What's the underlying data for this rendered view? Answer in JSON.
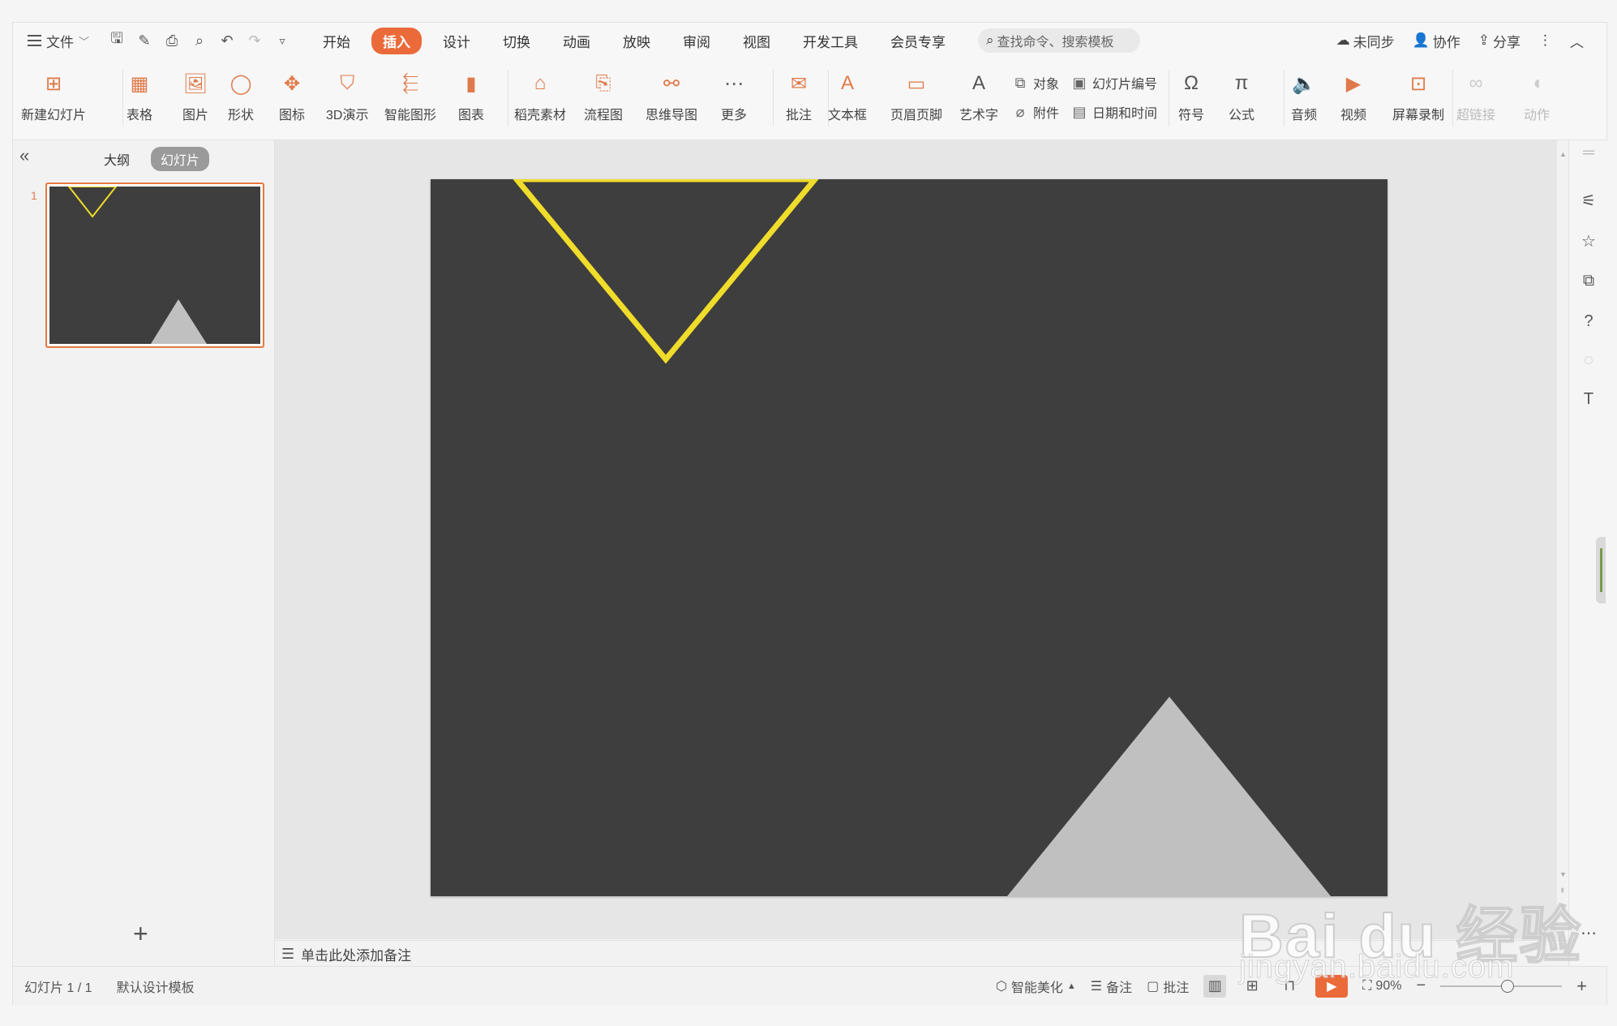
{
  "menubar": {
    "file_label": "文件",
    "tabs": [
      "开始",
      "插入",
      "设计",
      "切换",
      "动画",
      "放映",
      "审阅",
      "视图",
      "开发工具",
      "会员专享"
    ],
    "active_tab": "插入",
    "search_placeholder": "查找命令、搜索模板",
    "sync_label": "未同步",
    "collab_label": "协作",
    "share_label": "分享"
  },
  "ribbon": {
    "new_slide": "新建幻灯片",
    "table": "表格",
    "picture": "图片",
    "shape": "形状",
    "icon": "图标",
    "demo3d": "3D演示",
    "smartart": "智能图形",
    "chart": "图表",
    "daoke": "稻壳素材",
    "flowchart": "流程图",
    "mindmap": "思维导图",
    "more": "更多",
    "comment": "批注",
    "textbox": "文本框",
    "headerfooter": "页眉页脚",
    "wordart": "艺术字",
    "object": "对象",
    "attachment": "附件",
    "slide_number": "幻灯片编号",
    "datetime": "日期和时间",
    "symbol": "符号",
    "formula": "公式",
    "audio": "音频",
    "video": "视频",
    "screenrec": "屏幕录制",
    "hyperlink": "超链接",
    "action": "动作"
  },
  "leftpanel": {
    "tab_outline": "大纲",
    "tab_slides": "幻灯片",
    "slide_number": "1"
  },
  "notes": {
    "placeholder": "单击此处添加备注"
  },
  "statusbar": {
    "slide_counter": "幻灯片 1 / 1",
    "template": "默认设计模板",
    "beautify": "智能美化",
    "notes": "备注",
    "comment": "批注",
    "zoom": "90%"
  },
  "slide": {
    "background": "#3e3e3e",
    "triangle_outline_color": "#f0dc2a",
    "triangle_fill_color": "#c0c0c0"
  },
  "theme": {
    "accent": "#eb6a3a"
  },
  "watermark": {
    "main": "Bai du 经验",
    "sub": "jingyan.baidu.com"
  }
}
